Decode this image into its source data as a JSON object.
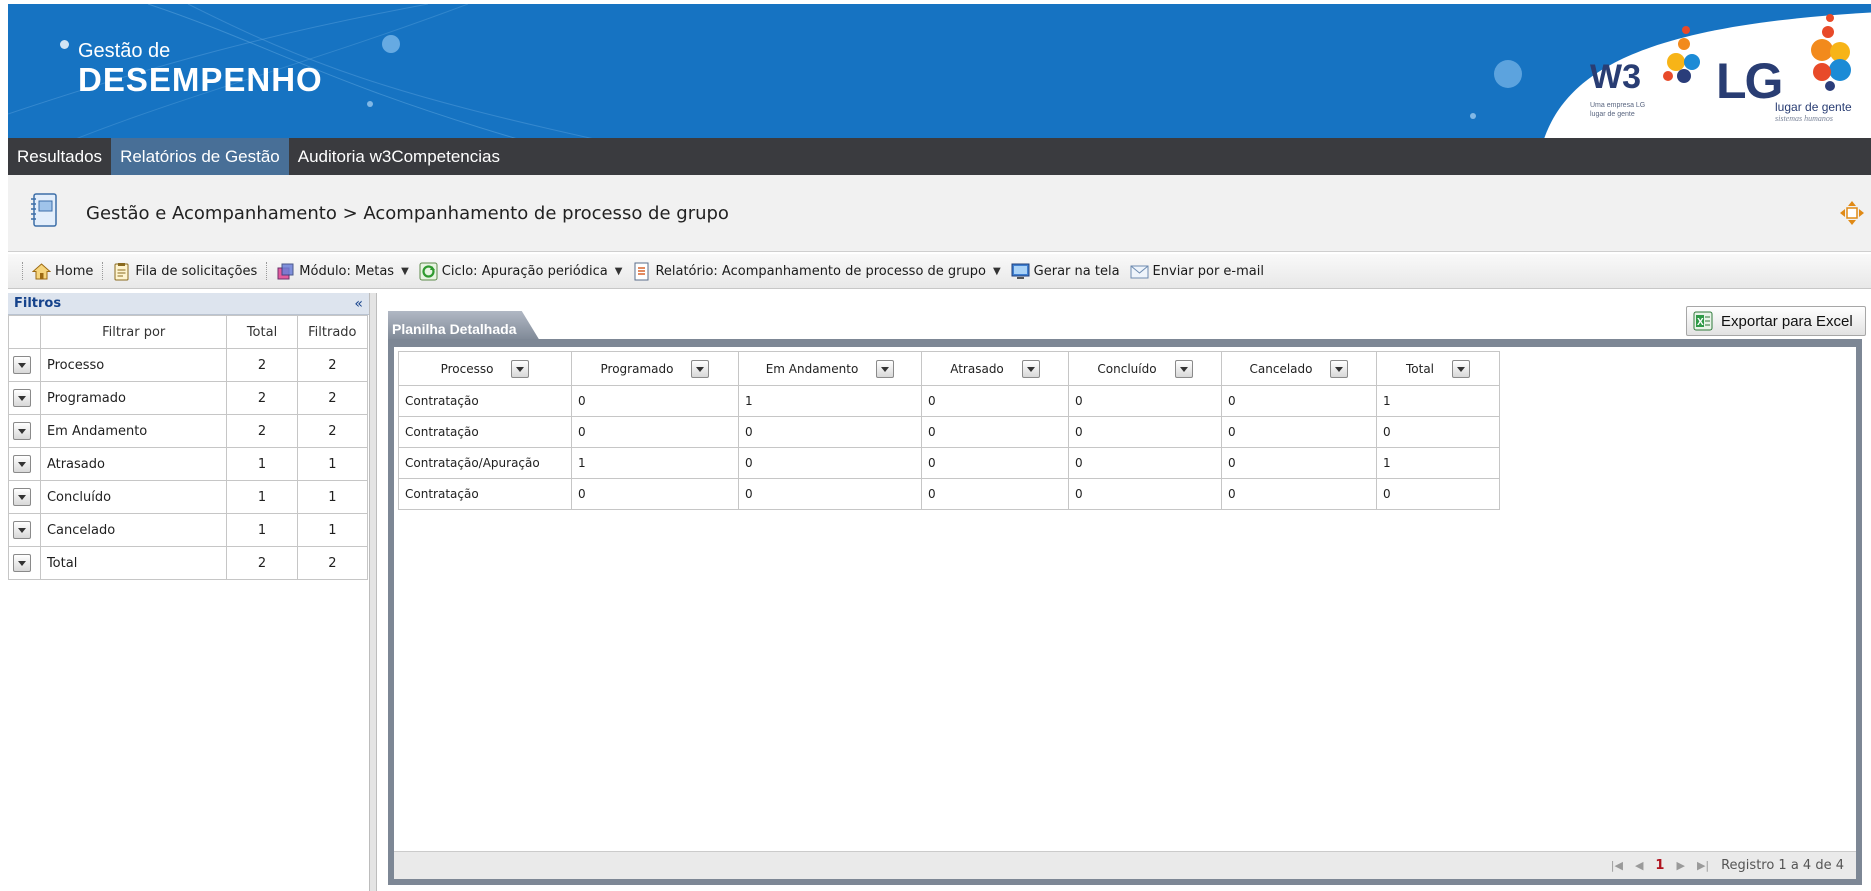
{
  "brand": {
    "line1": "Gestão de",
    "line2": "DESEMPENHO"
  },
  "logos": {
    "w3": "W3",
    "w3_sub": "Uma empresa LG lugar de gente",
    "lg": "LG",
    "lg_sub1": "lugar de gente",
    "lg_sub2": "sistemas humanos"
  },
  "menu": {
    "items": [
      {
        "label": "Resultados"
      },
      {
        "label": "Relatórios de Gestão"
      },
      {
        "label": "Auditoria w3Competencias"
      }
    ],
    "active": "Relatórios de Gestão"
  },
  "page": {
    "title": "Gestão e Acompanhamento > Acompanhamento de processo de grupo"
  },
  "toolbar": {
    "home": "Home",
    "queue": "Fila de solicitações",
    "module": "Módulo: Metas",
    "cycle": "Ciclo: Apuração periódica",
    "report": "Relatório: Acompanhamento de processo de grupo",
    "generate": "Gerar na tela",
    "email": "Enviar por e-mail"
  },
  "filters": {
    "title": "Filtros",
    "collapse_icon": "«",
    "headers": {
      "filter_by": "Filtrar por",
      "total": "Total",
      "filtered": "Filtrado"
    },
    "rows": [
      {
        "label": "Processo",
        "total": "2",
        "filtered": "2"
      },
      {
        "label": "Programado",
        "total": "2",
        "filtered": "2"
      },
      {
        "label": "Em Andamento",
        "total": "2",
        "filtered": "2"
      },
      {
        "label": "Atrasado",
        "total": "1",
        "filtered": "1"
      },
      {
        "label": "Concluído",
        "total": "1",
        "filtered": "1"
      },
      {
        "label": "Cancelado",
        "total": "1",
        "filtered": "1"
      },
      {
        "label": "Total",
        "total": "2",
        "filtered": "2"
      }
    ]
  },
  "main": {
    "tab": "Planilha Detalhada",
    "export_label": "Exportar para Excel",
    "columns": [
      "Processo",
      "Programado",
      "Em Andamento",
      "Atrasado",
      "Concluído",
      "Cancelado",
      "Total"
    ],
    "rows": [
      [
        "Contratação",
        "0",
        "1",
        "0",
        "0",
        "0",
        "1"
      ],
      [
        "Contratação",
        "0",
        "0",
        "0",
        "0",
        "0",
        "0"
      ],
      [
        "Contratação/Apuração",
        "1",
        "0",
        "0",
        "0",
        "0",
        "1"
      ],
      [
        "Contratação",
        "0",
        "0",
        "0",
        "0",
        "0",
        "0"
      ]
    ],
    "pager": {
      "current_page": "1",
      "summary": "Registro 1 a 4 de 4"
    }
  },
  "colors": {
    "banner": "#1673c2",
    "menu": "#3a3b3f",
    "menu_active": "#486f97",
    "tab": "#7d8795",
    "pager_current": "#b0141f"
  }
}
